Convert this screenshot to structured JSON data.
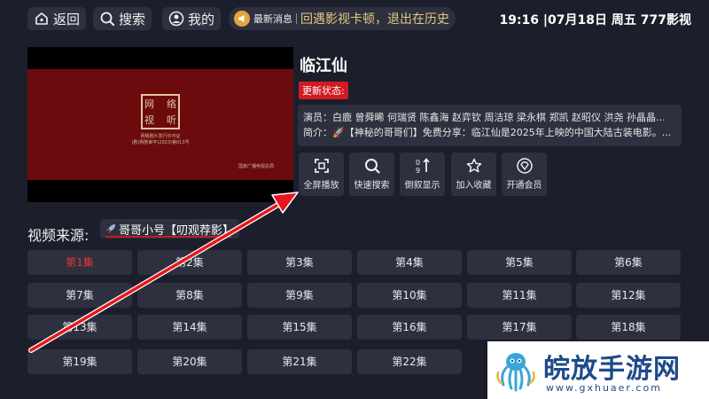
{
  "nav": {
    "back_label": "返回",
    "search_label": "搜索",
    "mine_label": "我的"
  },
  "ticker": {
    "label": "最新消息",
    "text": "回遇影视卡顿，退出在历史"
  },
  "status_bar": {
    "time": "19:16",
    "date": "07月18日",
    "weekday": "周五",
    "app_name": "777影视"
  },
  "player": {
    "seal_chars": [
      "网",
      "络",
      "视",
      "听"
    ],
    "license_line1": "网络剧片发行许可证",
    "license_line2": "(剧)网剧审字(2023)第013号",
    "approver": "国家广播电视总局"
  },
  "detail": {
    "title": "临江仙",
    "update_badge": "更新状态:",
    "actors": "演员：白鹿 曾舜晞 何瑞贤 陈鑫海 赵弈钦 周洁琼 梁永棋 郑凯 赵昭仪 洪尧 孙晶晶...",
    "summary": "简介：🚀【神秘的哥哥们】免费分享：临江仙是2025年上映的中国大陆古装电影。..."
  },
  "actions": [
    {
      "label": "全屏播放",
      "icon": "fullscreen-icon"
    },
    {
      "label": "快速搜索",
      "icon": "search-icon"
    },
    {
      "label": "倒叙显示",
      "icon": "sort-icon"
    },
    {
      "label": "加入收藏",
      "icon": "star-icon"
    },
    {
      "label": "开通会员",
      "icon": "diamond-icon"
    }
  ],
  "source": {
    "label": "视频来源:",
    "value": "哥哥小号【叨观荐影】"
  },
  "episodes": [
    "第1集",
    "第2集",
    "第3集",
    "第4集",
    "第5集",
    "第6集",
    "第7集",
    "第8集",
    "第9集",
    "第10集",
    "第11集",
    "第12集",
    "第13集",
    "第14集",
    "第15集",
    "第16集",
    "第17集",
    "第18集",
    "第19集",
    "第20集",
    "第21集",
    "第22集"
  ],
  "active_episode_index": 0,
  "watermark": {
    "title": "皖放手游网",
    "url": "www.gxhuaer.com"
  },
  "colors": {
    "background": "#1c1f2b",
    "panel": "#2d313f",
    "accent_red": "#d21a24",
    "active_episode": "#e53935",
    "ticker_text": "#e6c680"
  }
}
